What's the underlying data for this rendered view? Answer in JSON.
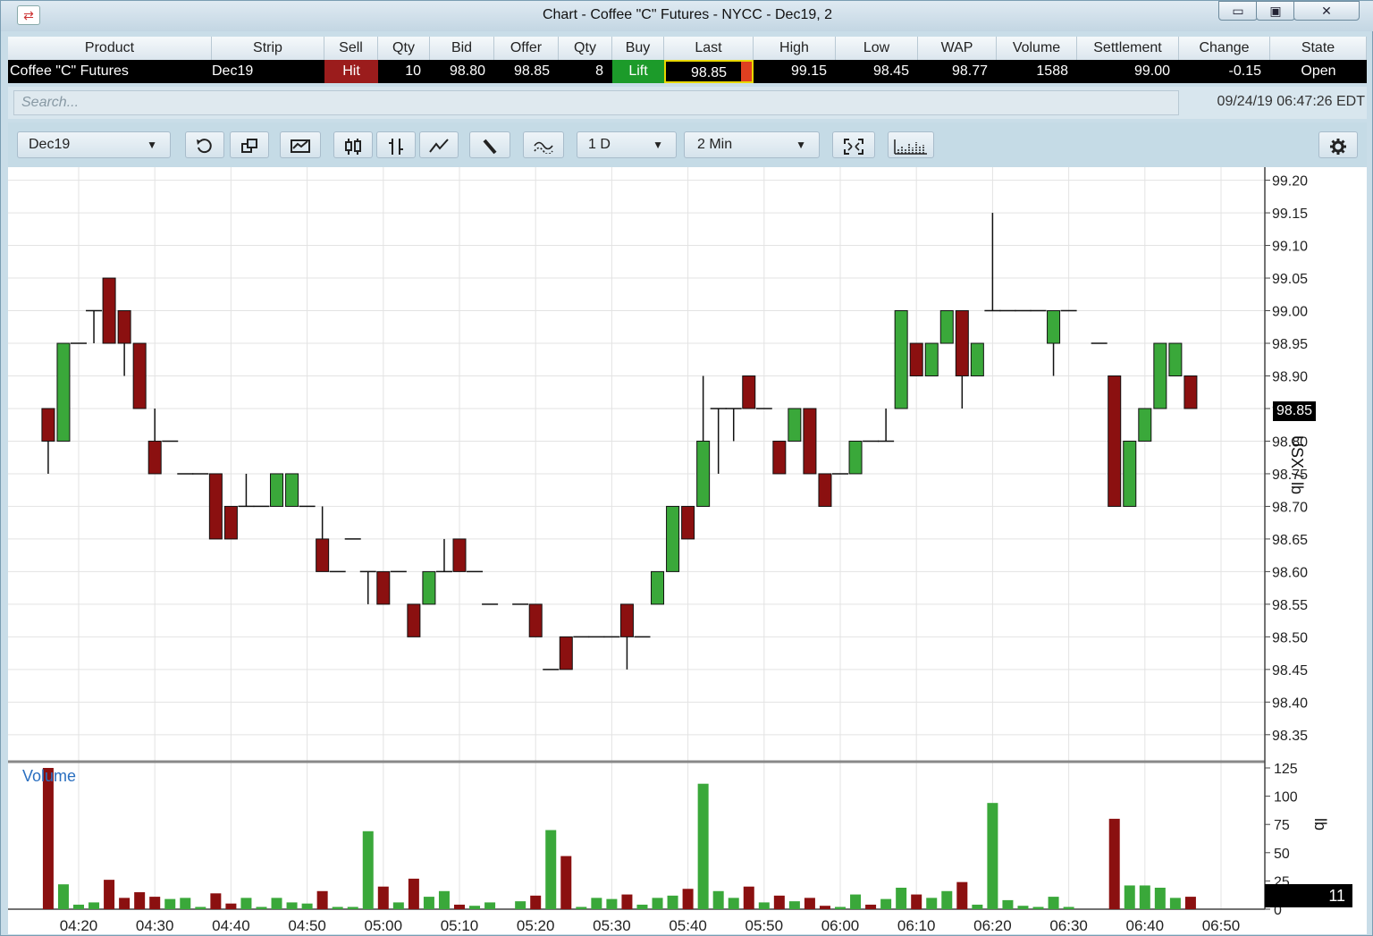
{
  "window": {
    "title": "Chart - Coffee \"C\" Futures - NYCC - Dec19, 2",
    "controls": [
      "minimize",
      "maximize",
      "close"
    ]
  },
  "quote": {
    "headers": [
      "Product",
      "Strip",
      "Sell",
      "Qty",
      "Bid",
      "Offer",
      "Qty",
      "Buy",
      "Last",
      "High",
      "Low",
      "WAP",
      "Volume",
      "Settlement",
      "Change",
      "State"
    ],
    "row": [
      "Coffee \"C\" Futures",
      "Dec19",
      "Hit",
      "10",
      "98.80",
      "98.85",
      "8",
      "Lift",
      "98.85",
      "99.15",
      "98.45",
      "98.77",
      "1588",
      "99.00",
      "-0.15",
      "Open"
    ],
    "colors": {
      "sell_bg": "#9b1c1c",
      "buy_bg": "#1c9b2a",
      "last_border": "#e8d800",
      "last_flag": "#e04020"
    }
  },
  "search": {
    "placeholder": "Search...",
    "clock": "09/24/19 06:47:26 EDT"
  },
  "toolbar": {
    "strip_select": "Dec19",
    "range_select": "1 D",
    "interval_select": "2 Min",
    "icons": [
      "reset-icon",
      "window-duplicate-icon",
      "chart-type-icon",
      "candlestick-icon",
      "ohlc-bars-icon",
      "line-chart-icon",
      "draw-line-icon",
      "studies-icon",
      "fit-view-icon",
      "volume-toggle-icon",
      "settings-gear-icon"
    ]
  },
  "chart_labels": {
    "volume_label": "Volume",
    "price_unit": "USX / lb",
    "volume_unit": "lb",
    "last_price_tag": "98.85",
    "last_volume_tag": "11"
  },
  "chart_data": {
    "type": "candlestick",
    "x_start": "04:14",
    "interval_minutes": 2,
    "x_ticks": [
      "04:20",
      "04:30",
      "04:40",
      "04:50",
      "05:00",
      "05:10",
      "05:20",
      "05:30",
      "05:40",
      "05:50",
      "06:00",
      "06:10",
      "06:20",
      "06:30",
      "06:40",
      "06:50"
    ],
    "price_ticks": [
      "99.20",
      "99.15",
      "99.10",
      "99.05",
      "99.00",
      "98.95",
      "98.90",
      "98.85",
      "98.80",
      "98.75",
      "98.70",
      "98.65",
      "98.60",
      "98.55",
      "98.50",
      "98.45",
      "98.40",
      "98.35"
    ],
    "price_range": [
      98.31,
      99.22
    ],
    "volume_ticks": [
      "125",
      "100",
      "75",
      "50",
      "25",
      "0"
    ],
    "volume_range": [
      0,
      125
    ],
    "grid": true,
    "colors": {
      "up": "#3aa83a",
      "down": "#8b1010",
      "doji": "#000000"
    },
    "candles": [
      {
        "t": "04:16",
        "o": 98.85,
        "h": 98.85,
        "l": 98.75,
        "c": 98.8
      },
      {
        "t": "04:18",
        "o": 98.8,
        "h": 98.95,
        "l": 98.8,
        "c": 98.95
      },
      {
        "t": "04:20",
        "o": 98.95,
        "h": 98.95,
        "l": 98.95,
        "c": 98.95
      },
      {
        "t": "04:22",
        "o": 99.0,
        "h": 99.0,
        "l": 98.95,
        "c": 99.0
      },
      {
        "t": "04:24",
        "o": 99.05,
        "h": 99.05,
        "l": 98.95,
        "c": 98.95
      },
      {
        "t": "04:26",
        "o": 99.0,
        "h": 99.0,
        "l": 98.9,
        "c": 98.95
      },
      {
        "t": "04:28",
        "o": 98.95,
        "h": 98.95,
        "l": 98.85,
        "c": 98.85
      },
      {
        "t": "04:30",
        "o": 98.8,
        "h": 98.85,
        "l": 98.75,
        "c": 98.75
      },
      {
        "t": "04:32",
        "o": 98.8,
        "h": 98.8,
        "l": 98.8,
        "c": 98.8
      },
      {
        "t": "04:34",
        "o": 98.75,
        "h": 98.75,
        "l": 98.75,
        "c": 98.75
      },
      {
        "t": "04:36",
        "o": 98.75,
        "h": 98.75,
        "l": 98.75,
        "c": 98.75
      },
      {
        "t": "04:38",
        "o": 98.75,
        "h": 98.75,
        "l": 98.65,
        "c": 98.65
      },
      {
        "t": "04:40",
        "o": 98.7,
        "h": 98.7,
        "l": 98.65,
        "c": 98.65
      },
      {
        "t": "04:42",
        "o": 98.7,
        "h": 98.75,
        "l": 98.7,
        "c": 98.7
      },
      {
        "t": "04:44",
        "o": 98.7,
        "h": 98.7,
        "l": 98.7,
        "c": 98.7
      },
      {
        "t": "04:46",
        "o": 98.7,
        "h": 98.75,
        "l": 98.7,
        "c": 98.75
      },
      {
        "t": "04:48",
        "o": 98.7,
        "h": 98.75,
        "l": 98.7,
        "c": 98.75
      },
      {
        "t": "04:50",
        "o": 98.7,
        "h": 98.7,
        "l": 98.7,
        "c": 98.7
      },
      {
        "t": "04:52",
        "o": 98.65,
        "h": 98.7,
        "l": 98.6,
        "c": 98.6
      },
      {
        "t": "04:54",
        "o": 98.6,
        "h": 98.6,
        "l": 98.6,
        "c": 98.6
      },
      {
        "t": "04:56",
        "o": 98.65,
        "h": 98.65,
        "l": 98.65,
        "c": 98.65
      },
      {
        "t": "04:58",
        "o": 98.6,
        "h": 98.6,
        "l": 98.55,
        "c": 98.6
      },
      {
        "t": "05:00",
        "o": 98.6,
        "h": 98.6,
        "l": 98.55,
        "c": 98.55
      },
      {
        "t": "05:02",
        "o": 98.6,
        "h": 98.6,
        "l": 98.6,
        "c": 98.6
      },
      {
        "t": "05:04",
        "o": 98.55,
        "h": 98.55,
        "l": 98.5,
        "c": 98.5
      },
      {
        "t": "05:06",
        "o": 98.55,
        "h": 98.6,
        "l": 98.55,
        "c": 98.6
      },
      {
        "t": "05:08",
        "o": 98.6,
        "h": 98.65,
        "l": 98.6,
        "c": 98.6
      },
      {
        "t": "05:10",
        "o": 98.65,
        "h": 98.65,
        "l": 98.6,
        "c": 98.6
      },
      {
        "t": "05:12",
        "o": 98.6,
        "h": 98.6,
        "l": 98.6,
        "c": 98.6
      },
      {
        "t": "05:14",
        "o": 98.55,
        "h": 98.55,
        "l": 98.55,
        "c": 98.55
      },
      {
        "t": "05:18",
        "o": 98.55,
        "h": 98.55,
        "l": 98.55,
        "c": 98.55
      },
      {
        "t": "05:20",
        "o": 98.55,
        "h": 98.55,
        "l": 98.5,
        "c": 98.5
      },
      {
        "t": "05:22",
        "o": 98.45,
        "h": 98.45,
        "l": 98.45,
        "c": 98.45
      },
      {
        "t": "05:24",
        "o": 98.5,
        "h": 98.5,
        "l": 98.45,
        "c": 98.45
      },
      {
        "t": "05:26",
        "o": 98.5,
        "h": 98.5,
        "l": 98.5,
        "c": 98.5
      },
      {
        "t": "05:28",
        "o": 98.5,
        "h": 98.5,
        "l": 98.5,
        "c": 98.5
      },
      {
        "t": "05:30",
        "o": 98.5,
        "h": 98.5,
        "l": 98.5,
        "c": 98.5
      },
      {
        "t": "05:32",
        "o": 98.55,
        "h": 98.55,
        "l": 98.45,
        "c": 98.5
      },
      {
        "t": "05:34",
        "o": 98.5,
        "h": 98.5,
        "l": 98.5,
        "c": 98.5
      },
      {
        "t": "05:36",
        "o": 98.55,
        "h": 98.6,
        "l": 98.55,
        "c": 98.6
      },
      {
        "t": "05:38",
        "o": 98.6,
        "h": 98.7,
        "l": 98.6,
        "c": 98.7
      },
      {
        "t": "05:40",
        "o": 98.7,
        "h": 98.7,
        "l": 98.65,
        "c": 98.65
      },
      {
        "t": "05:42",
        "o": 98.7,
        "h": 98.9,
        "l": 98.7,
        "c": 98.8
      },
      {
        "t": "05:44",
        "o": 98.85,
        "h": 98.85,
        "l": 98.75,
        "c": 98.85
      },
      {
        "t": "05:46",
        "o": 98.85,
        "h": 98.85,
        "l": 98.8,
        "c": 98.85
      },
      {
        "t": "05:48",
        "o": 98.9,
        "h": 98.9,
        "l": 98.85,
        "c": 98.85
      },
      {
        "t": "05:50",
        "o": 98.85,
        "h": 98.85,
        "l": 98.85,
        "c": 98.85
      },
      {
        "t": "05:52",
        "o": 98.8,
        "h": 98.8,
        "l": 98.75,
        "c": 98.75
      },
      {
        "t": "05:54",
        "o": 98.8,
        "h": 98.85,
        "l": 98.8,
        "c": 98.85
      },
      {
        "t": "05:56",
        "o": 98.85,
        "h": 98.85,
        "l": 98.75,
        "c": 98.75
      },
      {
        "t": "05:58",
        "o": 98.75,
        "h": 98.75,
        "l": 98.7,
        "c": 98.7
      },
      {
        "t": "06:00",
        "o": 98.75,
        "h": 98.75,
        "l": 98.75,
        "c": 98.75
      },
      {
        "t": "06:02",
        "o": 98.75,
        "h": 98.8,
        "l": 98.75,
        "c": 98.8
      },
      {
        "t": "06:04",
        "o": 98.8,
        "h": 98.8,
        "l": 98.8,
        "c": 98.8
      },
      {
        "t": "06:06",
        "o": 98.8,
        "h": 98.85,
        "l": 98.8,
        "c": 98.8
      },
      {
        "t": "06:08",
        "o": 98.85,
        "h": 99.0,
        "l": 98.85,
        "c": 99.0
      },
      {
        "t": "06:10",
        "o": 98.95,
        "h": 98.95,
        "l": 98.9,
        "c": 98.9
      },
      {
        "t": "06:12",
        "o": 98.9,
        "h": 98.95,
        "l": 98.9,
        "c": 98.95
      },
      {
        "t": "06:14",
        "o": 98.95,
        "h": 99.0,
        "l": 98.95,
        "c": 99.0
      },
      {
        "t": "06:16",
        "o": 99.0,
        "h": 99.0,
        "l": 98.85,
        "c": 98.9
      },
      {
        "t": "06:18",
        "o": 98.9,
        "h": 98.95,
        "l": 98.9,
        "c": 98.95
      },
      {
        "t": "06:20",
        "o": 99.0,
        "h": 99.15,
        "l": 99.0,
        "c": 99.0
      },
      {
        "t": "06:22",
        "o": 99.0,
        "h": 99.0,
        "l": 99.0,
        "c": 99.0
      },
      {
        "t": "06:24",
        "o": 99.0,
        "h": 99.0,
        "l": 99.0,
        "c": 99.0
      },
      {
        "t": "06:26",
        "o": 99.0,
        "h": 99.0,
        "l": 99.0,
        "c": 99.0
      },
      {
        "t": "06:28",
        "o": 98.95,
        "h": 99.0,
        "l": 98.9,
        "c": 99.0
      },
      {
        "t": "06:30",
        "o": 99.0,
        "h": 99.0,
        "l": 99.0,
        "c": 99.0
      },
      {
        "t": "06:34",
        "o": 98.95,
        "h": 98.95,
        "l": 98.95,
        "c": 98.95
      },
      {
        "t": "06:36",
        "o": 98.9,
        "h": 98.9,
        "l": 98.7,
        "c": 98.7
      },
      {
        "t": "06:38",
        "o": 98.7,
        "h": 98.8,
        "l": 98.7,
        "c": 98.8
      },
      {
        "t": "06:40",
        "o": 98.8,
        "h": 98.85,
        "l": 98.8,
        "c": 98.85
      },
      {
        "t": "06:42",
        "o": 98.85,
        "h": 98.95,
        "l": 98.85,
        "c": 98.95
      },
      {
        "t": "06:44",
        "o": 98.9,
        "h": 98.95,
        "l": 98.9,
        "c": 98.95
      },
      {
        "t": "06:46",
        "o": 98.9,
        "h": 98.9,
        "l": 98.85,
        "c": 98.85
      }
    ],
    "volumes": [
      {
        "t": "04:16",
        "v": 125,
        "dir": "down"
      },
      {
        "t": "04:18",
        "v": 22,
        "dir": "up"
      },
      {
        "t": "04:20",
        "v": 4,
        "dir": "up"
      },
      {
        "t": "04:22",
        "v": 6,
        "dir": "up"
      },
      {
        "t": "04:24",
        "v": 26,
        "dir": "down"
      },
      {
        "t": "04:26",
        "v": 10,
        "dir": "down"
      },
      {
        "t": "04:28",
        "v": 15,
        "dir": "down"
      },
      {
        "t": "04:30",
        "v": 11,
        "dir": "down"
      },
      {
        "t": "04:32",
        "v": 9,
        "dir": "up"
      },
      {
        "t": "04:34",
        "v": 10,
        "dir": "up"
      },
      {
        "t": "04:36",
        "v": 2,
        "dir": "up"
      },
      {
        "t": "04:38",
        "v": 14,
        "dir": "down"
      },
      {
        "t": "04:40",
        "v": 5,
        "dir": "down"
      },
      {
        "t": "04:42",
        "v": 10,
        "dir": "up"
      },
      {
        "t": "04:44",
        "v": 2,
        "dir": "up"
      },
      {
        "t": "04:46",
        "v": 10,
        "dir": "up"
      },
      {
        "t": "04:48",
        "v": 6,
        "dir": "up"
      },
      {
        "t": "04:50",
        "v": 5,
        "dir": "up"
      },
      {
        "t": "04:52",
        "v": 16,
        "dir": "down"
      },
      {
        "t": "04:54",
        "v": 2,
        "dir": "up"
      },
      {
        "t": "04:56",
        "v": 2,
        "dir": "up"
      },
      {
        "t": "04:58",
        "v": 69,
        "dir": "up"
      },
      {
        "t": "05:00",
        "v": 20,
        "dir": "down"
      },
      {
        "t": "05:02",
        "v": 6,
        "dir": "up"
      },
      {
        "t": "05:04",
        "v": 27,
        "dir": "down"
      },
      {
        "t": "05:06",
        "v": 11,
        "dir": "up"
      },
      {
        "t": "05:08",
        "v": 16,
        "dir": "up"
      },
      {
        "t": "05:10",
        "v": 4,
        "dir": "down"
      },
      {
        "t": "05:12",
        "v": 3,
        "dir": "up"
      },
      {
        "t": "05:14",
        "v": 6,
        "dir": "up"
      },
      {
        "t": "05:18",
        "v": 7,
        "dir": "up"
      },
      {
        "t": "05:20",
        "v": 12,
        "dir": "down"
      },
      {
        "t": "05:22",
        "v": 70,
        "dir": "up"
      },
      {
        "t": "05:24",
        "v": 47,
        "dir": "down"
      },
      {
        "t": "05:26",
        "v": 2,
        "dir": "up"
      },
      {
        "t": "05:28",
        "v": 10,
        "dir": "up"
      },
      {
        "t": "05:30",
        "v": 9,
        "dir": "up"
      },
      {
        "t": "05:32",
        "v": 13,
        "dir": "down"
      },
      {
        "t": "05:34",
        "v": 4,
        "dir": "up"
      },
      {
        "t": "05:36",
        "v": 10,
        "dir": "up"
      },
      {
        "t": "05:38",
        "v": 12,
        "dir": "up"
      },
      {
        "t": "05:40",
        "v": 18,
        "dir": "down"
      },
      {
        "t": "05:42",
        "v": 111,
        "dir": "up"
      },
      {
        "t": "05:44",
        "v": 16,
        "dir": "up"
      },
      {
        "t": "05:46",
        "v": 10,
        "dir": "up"
      },
      {
        "t": "05:48",
        "v": 20,
        "dir": "down"
      },
      {
        "t": "05:50",
        "v": 6,
        "dir": "up"
      },
      {
        "t": "05:52",
        "v": 12,
        "dir": "down"
      },
      {
        "t": "05:54",
        "v": 7,
        "dir": "up"
      },
      {
        "t": "05:56",
        "v": 10,
        "dir": "down"
      },
      {
        "t": "05:58",
        "v": 3,
        "dir": "down"
      },
      {
        "t": "06:00",
        "v": 2,
        "dir": "up"
      },
      {
        "t": "06:02",
        "v": 13,
        "dir": "up"
      },
      {
        "t": "06:04",
        "v": 4,
        "dir": "down"
      },
      {
        "t": "06:06",
        "v": 9,
        "dir": "up"
      },
      {
        "t": "06:08",
        "v": 19,
        "dir": "up"
      },
      {
        "t": "06:10",
        "v": 13,
        "dir": "down"
      },
      {
        "t": "06:12",
        "v": 10,
        "dir": "up"
      },
      {
        "t": "06:14",
        "v": 16,
        "dir": "up"
      },
      {
        "t": "06:16",
        "v": 24,
        "dir": "down"
      },
      {
        "t": "06:18",
        "v": 4,
        "dir": "up"
      },
      {
        "t": "06:20",
        "v": 94,
        "dir": "up"
      },
      {
        "t": "06:22",
        "v": 8,
        "dir": "up"
      },
      {
        "t": "06:24",
        "v": 3,
        "dir": "up"
      },
      {
        "t": "06:26",
        "v": 2,
        "dir": "up"
      },
      {
        "t": "06:28",
        "v": 11,
        "dir": "up"
      },
      {
        "t": "06:30",
        "v": 2,
        "dir": "up"
      },
      {
        "t": "06:36",
        "v": 80,
        "dir": "down"
      },
      {
        "t": "06:38",
        "v": 21,
        "dir": "up"
      },
      {
        "t": "06:40",
        "v": 21,
        "dir": "up"
      },
      {
        "t": "06:42",
        "v": 19,
        "dir": "up"
      },
      {
        "t": "06:44",
        "v": 10,
        "dir": "up"
      },
      {
        "t": "06:46",
        "v": 11,
        "dir": "down"
      }
    ]
  }
}
